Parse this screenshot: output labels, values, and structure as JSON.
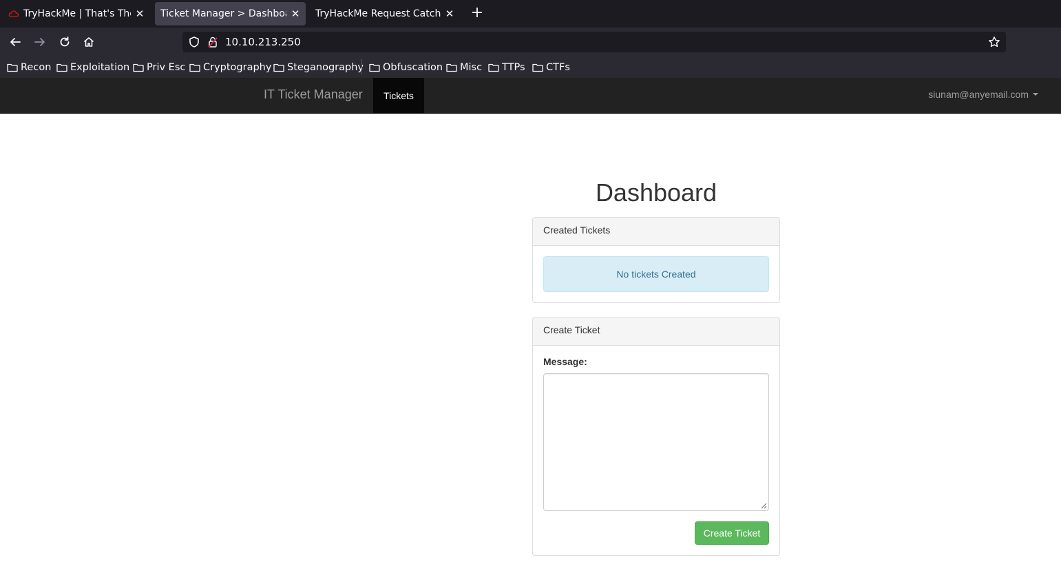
{
  "browser": {
    "tabs": [
      {
        "title": "TryHackMe | That's The Ti",
        "favicon": "tryhackme-cloud-icon",
        "active": false
      },
      {
        "title": "Ticket Manager > Dashboard",
        "favicon": "",
        "active": true
      },
      {
        "title": "TryHackMe Request Catcher",
        "favicon": "",
        "active": false
      }
    ],
    "new_tab_label": "+",
    "url": "10.10.213.250",
    "bookmarks": [
      "Recon",
      "Exploitation",
      "Priv Esc",
      "Cryptography",
      "Steganography",
      "Obfuscation",
      "Misc",
      "TTPs",
      "CTFs"
    ]
  },
  "app": {
    "brand": "IT Ticket Manager",
    "nav_tab": "Tickets",
    "user_email": "siunam@anyemail.com"
  },
  "dashboard": {
    "title": "Dashboard",
    "created_panel": {
      "heading": "Created Tickets",
      "empty_message": "No tickets Created"
    },
    "create_panel": {
      "heading": "Create Ticket",
      "message_label": "Message:",
      "message_value": "",
      "submit_label": "Create Ticket"
    }
  },
  "colors": {
    "tab_strip": "#1c1b22",
    "toolbar": "#2b2a33",
    "app_navbar": "#222222",
    "success_button": "#5cb85c",
    "info_alert": "#d9edf7"
  }
}
